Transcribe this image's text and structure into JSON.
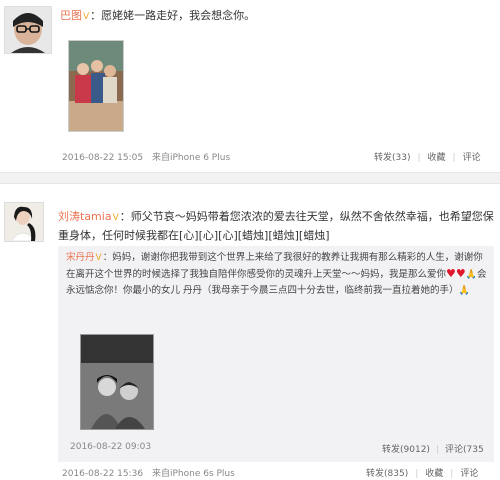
{
  "post1": {
    "username": "巴图",
    "content": "：愿姥姥一路走好，我会想念你。",
    "timestamp": "2016-08-22 15:05",
    "source": "来自iPhone 6 Plus",
    "repost": "转发(33)",
    "favorite": "收藏",
    "comment": "评论"
  },
  "post2": {
    "username": "刘涛tamia",
    "content": "：师父节哀～妈妈带着您浓浓的爱去往天堂，纵然不舍依然幸福，也希望您保重身体，任何时候我都在[心][心][心][蜡烛][蜡烛][蜡烛]",
    "timestamp": "2016-08-22 15:36",
    "source": "来自iPhone 6s Plus",
    "repost": "转发(835)",
    "favorite": "收藏",
    "comment": "评论"
  },
  "quoted": {
    "username": "宋丹丹",
    "content": "：妈妈，谢谢你把我带到这个世界上来给了我很好的教养让我拥有那么精彩的人生，谢谢你在离开这个世界的时候选择了我独自陪伴你感受你的灵魂升上天堂～～妈妈，我是那么爱你",
    "content2": "会永远惦念你！你最小的女儿 丹丹（我母亲于今晨三点四十分去世，临终前我一直拉着她的手）",
    "timestamp": "2016-08-22 09:03",
    "repost": "转发(9012)",
    "comment": "评论(735"
  },
  "colors": {
    "username": "#eb7350",
    "heart": "#e0162b",
    "meta": "#888888"
  },
  "icons": {
    "verified": "verified-badge-icon",
    "heart": "heart-icon",
    "pray": "pray-icon"
  }
}
